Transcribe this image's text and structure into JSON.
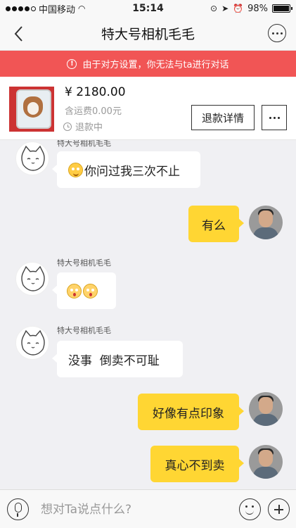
{
  "status_bar": {
    "carrier": "中国移动",
    "time": "15:14",
    "battery": "98%",
    "battery_level": 0.98
  },
  "nav": {
    "title": "特大号相机毛毛",
    "back_icon": "chevron-left-icon",
    "more_icon": "more-circle-icon"
  },
  "warning": {
    "text": "由于对方设置，你无法与ta进行对话",
    "icon": "info-icon",
    "color": "#f15555"
  },
  "product": {
    "price": "¥ 2180.00",
    "shipping": "含运费0.00元",
    "status": "退款中",
    "refund_button": "退款详情",
    "more_icon": "more-icon"
  },
  "messages": [
    {
      "side": "in",
      "sender": "特大号相机毛毛",
      "emoji": [
        "smile"
      ],
      "text": "你问过我三次不止"
    },
    {
      "side": "out",
      "text": "有么"
    },
    {
      "side": "in",
      "sender": "特大号相机毛毛",
      "emoji": [
        "shocked",
        "shocked"
      ],
      "text": ""
    },
    {
      "side": "in",
      "sender": "特大号相机毛毛",
      "text": "没事  倒卖不可耻"
    },
    {
      "side": "out",
      "text": "好像有点印象"
    },
    {
      "side": "out",
      "text": "真心不到卖"
    }
  ],
  "input_bar": {
    "placeholder": "想对Ta说点什么?",
    "voice_icon": "microphone-icon",
    "emoji_icon": "smiley-icon",
    "plus_icon": "plus-icon"
  },
  "colors": {
    "outgoing_bubble": "#ffd633",
    "incoming_bubble": "#ffffff",
    "chat_background": "#f0f0f3"
  }
}
